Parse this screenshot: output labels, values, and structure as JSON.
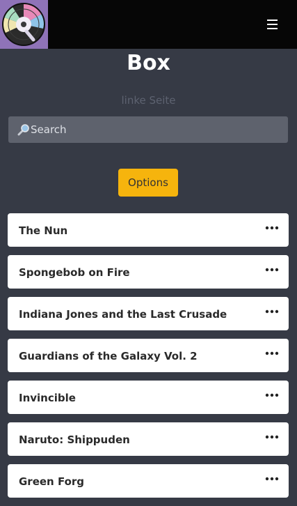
{
  "header": {
    "logo_icon": "vinyl-disc-icon",
    "menu_icon": "hamburger-menu-icon",
    "colors": {
      "bar": "#060606",
      "logo_bg": "#8f73b8"
    }
  },
  "page": {
    "title": "Box",
    "subtitle": "linke Seite"
  },
  "search": {
    "icon": "magnifier-icon",
    "placeholder": "Search",
    "value": ""
  },
  "options_button": {
    "label": "Options",
    "color": "#f6b40d"
  },
  "items": [
    {
      "title": "The Nun"
    },
    {
      "title": "Spongebob on Fire"
    },
    {
      "title": "Indiana Jones and the Last Crusade"
    },
    {
      "title": "Guardians of the Galaxy Vol. 2"
    },
    {
      "title": "Invincible"
    },
    {
      "title": "Naruto: Shippuden"
    },
    {
      "title": "Green Forg"
    }
  ],
  "item_action_icon": "more-horizontal-icon",
  "colors": {
    "background": "#363a45",
    "card": "#ffffff"
  }
}
